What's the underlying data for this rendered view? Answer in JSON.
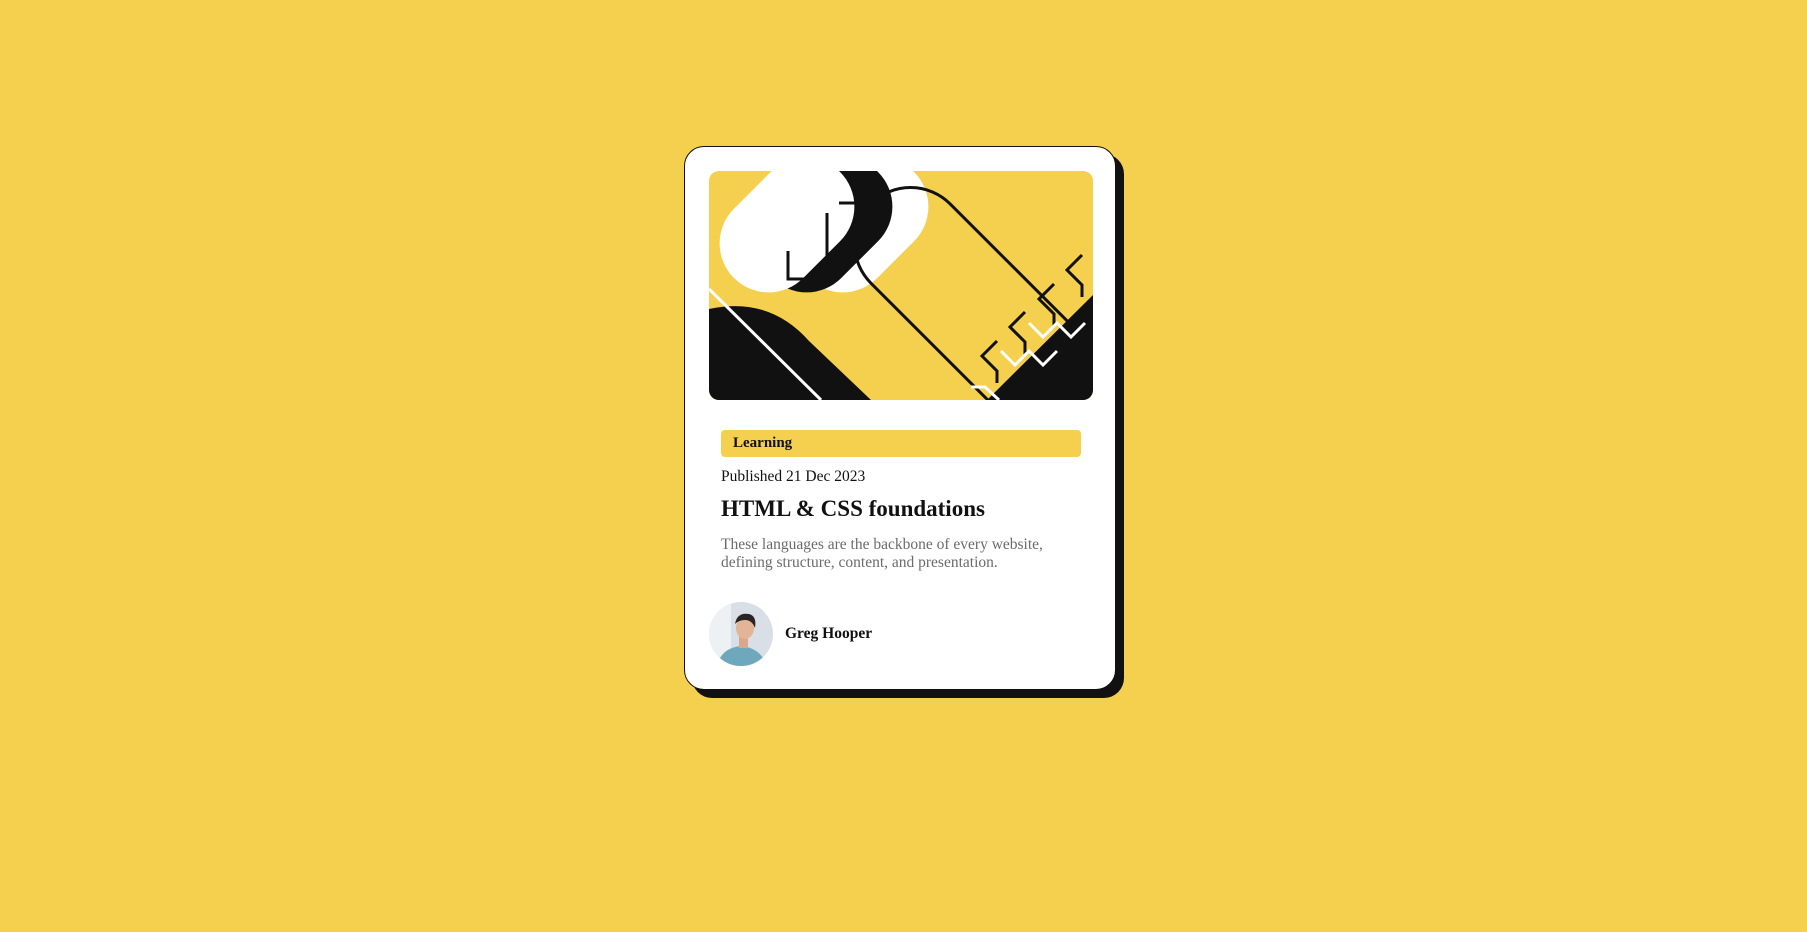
{
  "card": {
    "tag": "Learning",
    "published": "Published 21 Dec 2023",
    "title": "HTML & CSS foundations",
    "description": "These languages are the backbone of every website, defining structure, content, and presentation.",
    "hero_image": "abstract-illustration",
    "author": {
      "name": "Greg Hooper",
      "avatar": "author-portrait-photo"
    }
  },
  "colors": {
    "background": "#F4D04E",
    "card": "#FFFFFF",
    "ink": "#111111",
    "muted_text": "#6B6B6B",
    "tag_background": "#F4D04E"
  }
}
